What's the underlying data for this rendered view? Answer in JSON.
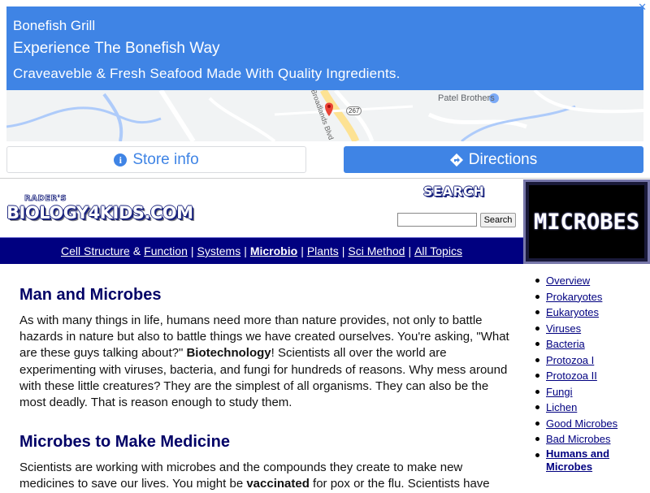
{
  "ad": {
    "brand": "Bonefish Grill",
    "headline": "Experience The Bonefish Way",
    "tagline": "Craveaveble & Fresh Seafood Made With Quality Ingredients.",
    "close_glyph": "✕",
    "map": {
      "place_label": "Patel Brothers",
      "road_label": "Broadlands Blvd",
      "route_label": "267"
    },
    "store_info_label": "Store info",
    "directions_label": "Directions",
    "info_icon_glyph": "i"
  },
  "header": {
    "logo_small": "RADER'S",
    "logo_main": "BIOLOGY4KIDS.COM",
    "search_title": "SEARCH",
    "search_value": "",
    "search_button": "Search",
    "section_badge": "MICROBES"
  },
  "nav": {
    "items": [
      "Cell Structure",
      "&",
      "Function",
      "Systems",
      "Microbio",
      "Plants",
      "Sci Method",
      "All Topics"
    ]
  },
  "main": {
    "title1": "Man and Microbes",
    "para1_part1": "As with many things in life, humans need more than nature provides, not only to battle hazards in nature but also to battle things we have created ourselves. You're asking, \"What are these guys talking about?\" ",
    "para1_bold": "Biotechnology",
    "para1_part2": "! Scientists all over the world are experimenting with viruses, bacteria, and fungi for hundreds of reasons. Why mess around with these little creatures? They are the simplest of all organisms. They can also be the most deadly. That is reason enough to study them.",
    "title2": "Microbes to Make Medicine",
    "para2_part1": "Scientists are working with microbes and the compounds they create to make new medicines to save our lives. You might be ",
    "para2_bold": "vaccinated",
    "para2_part2": " for pox or the flu. Scientists have"
  },
  "sidebar": {
    "items": [
      "Overview",
      "Prokaryotes",
      "Eukaryotes",
      "Viruses",
      "Bacteria",
      "Protozoa I",
      "Protozoa II",
      "Fungi",
      "Lichen",
      "Good Microbes",
      "Bad Microbes",
      "Humans and Microbes"
    ],
    "current": "Humans and Microbes"
  },
  "colors": {
    "ad_blue": "#3f84e5",
    "nav_bg": "#000080",
    "heading": "#000066",
    "link": "#000080"
  }
}
